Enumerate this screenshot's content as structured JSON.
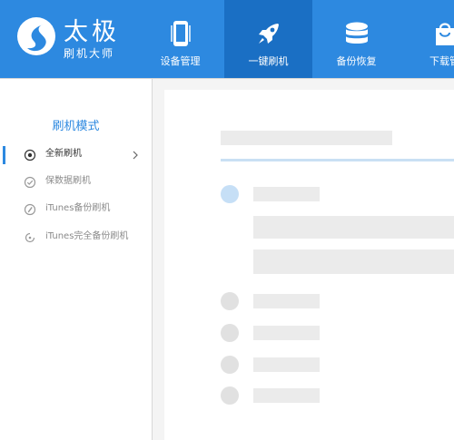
{
  "app": {
    "brand_name": "太极",
    "brand_subtitle": "刷机大师"
  },
  "nav": {
    "tabs": [
      {
        "label": "设备管理",
        "icon": "phone-icon",
        "active": false
      },
      {
        "label": "一键刷机",
        "icon": "rocket-icon",
        "active": true
      },
      {
        "label": "备份恢复",
        "icon": "database-icon",
        "active": false
      },
      {
        "label": "下载管",
        "icon": "shopping-bag-icon",
        "active": false
      }
    ]
  },
  "sidebar": {
    "title": "刷机模式",
    "items": [
      {
        "label": "全新刷机",
        "icon": "radio-dot-icon",
        "active": true
      },
      {
        "label": "保数据刷机",
        "icon": "check-circle-icon",
        "active": false
      },
      {
        "label": "iTunes备份刷机",
        "icon": "slash-circle-icon",
        "active": false
      },
      {
        "label": "iTunes完全备份刷机",
        "icon": "refresh-circle-icon",
        "active": false
      }
    ]
  },
  "colors": {
    "brand_blue": "#2d89e0",
    "active_tab": "#1a6fc4",
    "placeholder_gray": "#ebebeb",
    "step_active": "#c6dff6",
    "step_inactive": "#e1e1e1"
  }
}
